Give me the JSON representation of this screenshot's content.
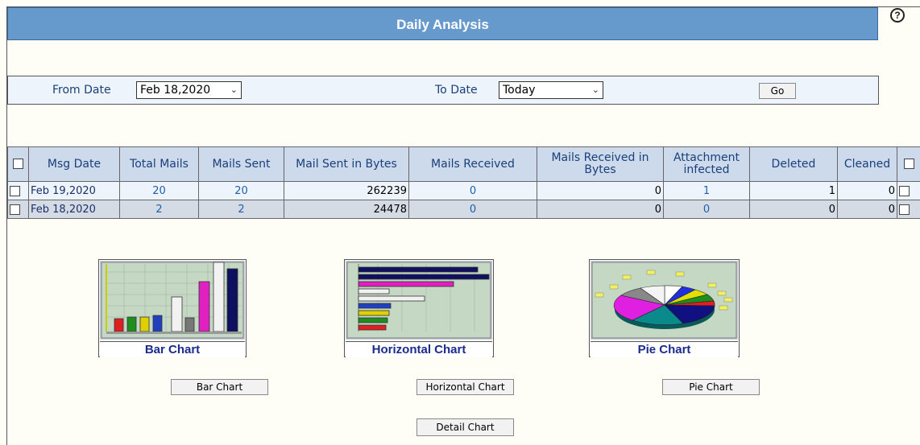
{
  "header": {
    "title": "Daily Analysis",
    "help_icon": "?"
  },
  "filters": {
    "from_label": "From Date",
    "from_value": "Feb 18,2020",
    "to_label": "To Date",
    "to_value": "Today",
    "go_label": "Go"
  },
  "table": {
    "columns": [
      "Msg Date",
      "Total Mails",
      "Mails Sent",
      "Mail Sent in Bytes",
      "Mails Received",
      "Mails Received in Bytes",
      "Attachment infected",
      "Deleted",
      "Cleaned"
    ],
    "rows": [
      {
        "msg_date": "Feb 19,2020",
        "total_mails": "20",
        "mails_sent": "20",
        "mail_sent_bytes": "262239",
        "mails_received": "0",
        "mails_received_bytes": "0",
        "attachment_infected": "1",
        "deleted": "1",
        "cleaned": "0"
      },
      {
        "msg_date": "Feb 18,2020",
        "total_mails": "2",
        "mails_sent": "2",
        "mail_sent_bytes": "24478",
        "mails_received": "0",
        "mails_received_bytes": "0",
        "attachment_infected": "0",
        "deleted": "0",
        "cleaned": "0"
      }
    ]
  },
  "charts": {
    "bar_caption": "Bar Chart",
    "horizontal_caption": "Horizontal Chart",
    "pie_caption": "Pie Chart",
    "bar_button": "Bar Chart",
    "horizontal_button": "Horizontal Chart",
    "pie_button": "Pie Chart",
    "detail_button": "Detail Chart"
  }
}
